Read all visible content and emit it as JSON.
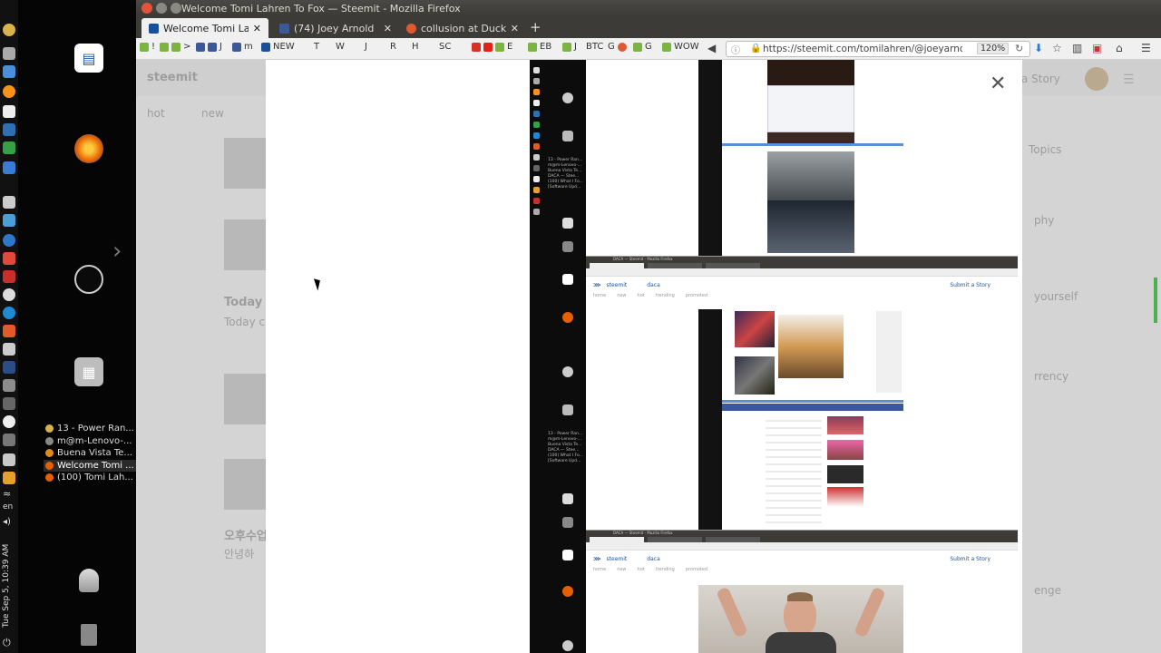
{
  "desktop": {
    "clock": "Tue Sep 5, 10:39 AM",
    "language": "en",
    "tasks": [
      {
        "label": "13 - Power Ran...",
        "color": "#d5b34a"
      },
      {
        "label": "m@m-Lenovo-...",
        "color": "#888888"
      },
      {
        "label": "Buena Vista Te...",
        "color": "#e08a1a"
      },
      {
        "label": "Welcome Tomi ...",
        "color": "#e66000",
        "active": true
      },
      {
        "label": "(100) Tomi Lah...",
        "color": "#e66000"
      }
    ]
  },
  "window": {
    "title": "Welcome Tomi Lahren To Fox — Steemit - Mozilla Firefox"
  },
  "tabs": [
    {
      "label": "Welcome Tomi Lahren",
      "active": true,
      "favicon_color": "#1a5099"
    },
    {
      "label": "(74) Joey Arnold",
      "active": false,
      "favicon_color": "#3b5998"
    },
    {
      "label": "collusion at DuckDuck",
      "active": false,
      "favicon_color": "#de5833"
    }
  ],
  "bookmarks": [
    "!",
    ">",
    "J",
    "m",
    "NEW",
    "T",
    "W",
    "J",
    "R",
    "H",
    "SC",
    "E",
    "EB",
    "J",
    "BTC",
    "G",
    "G",
    "WOW"
  ],
  "urlbar": {
    "url": "https://steemit.com/tomilahren/@joeyarnoldv",
    "zoom": "120%"
  },
  "background_page": {
    "logo": "steemit",
    "nav_hot": "hot",
    "nav_new": "new",
    "submit": "a Story",
    "topics": "Topics",
    "today_title": "Today w",
    "today_sub": "Today c",
    "korean_title": "오후수업",
    "korean_sub": "안녕하",
    "sidebar_1": "phy",
    "sidebar_2": "yourself",
    "sidebar_3": "rrency",
    "sidebar_4": "enge"
  },
  "nested": {
    "sub_title": "DACA — Steemit - Mozilla Firefox",
    "logo": "steemit",
    "tag": "daca",
    "submit": "Submit a Story",
    "nav": [
      "home",
      "new",
      "hot",
      "trending",
      "promoted"
    ],
    "dock_texts": [
      "13 - Power Ran...",
      "m@m-Lenovo-...",
      "Buena Vista Te...",
      "DACA — Stee...",
      "(100) What I Fo...",
      "[Software Upd..."
    ]
  }
}
